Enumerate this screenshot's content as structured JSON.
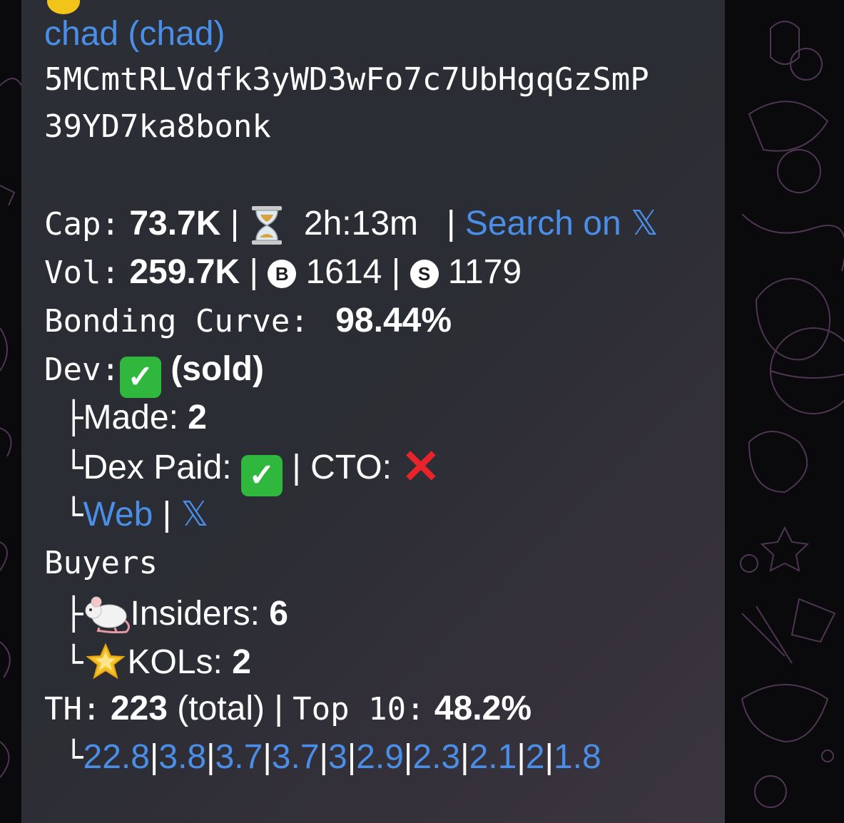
{
  "header": {
    "sender_link": "chad (chad)",
    "address_line1": "5MCmtRLVdfk3yWD3wFo7c7UbHgqGzSmP",
    "address_line2": "39YD7ka8bonk"
  },
  "cap": {
    "label": "Cap:",
    "value": "73.7K",
    "age": "2h:13m",
    "search_link": "Search on"
  },
  "vol": {
    "label": "Vol:",
    "value": "259.7K",
    "buy_icon_letter": "B",
    "buys": "1614",
    "sell_icon_letter": "S",
    "sells": "1179"
  },
  "bonding": {
    "label": "Bonding Curve:",
    "value": "98.44%"
  },
  "dev": {
    "label": "Dev:",
    "status": "(sold)",
    "made_label": "Made:",
    "made_value": "2",
    "dex_paid_label": "Dex Paid:",
    "cto_label": "CTO:",
    "web_link": "Web"
  },
  "buyers": {
    "label": "Buyers",
    "insiders_label": "Insiders:",
    "insiders_value": "6",
    "kols_label": "KOLs:",
    "kols_value": "2"
  },
  "holders": {
    "label": "TH:",
    "total_value": "223",
    "total_suffix": "(total)",
    "top10_label": "Top 10:",
    "top10_value": "48.2%",
    "top_list": [
      "22.8",
      "3.8",
      "3.7",
      "3.7",
      "3",
      "2.9",
      "2.3",
      "2.1",
      "2",
      "1.8"
    ]
  },
  "tree_glyphs": {
    "branch": "├",
    "last": "└"
  },
  "x_logo": "𝕏",
  "colors": {
    "link": "#4a8ee8",
    "check_green": "#2fb83d",
    "cross_red": "#e8232a",
    "bubble": "#2b2f35",
    "wallpaper": "#0a090c",
    "doodle": "#6a4a70"
  },
  "icons": [
    "hourglass-icon",
    "buy-coin-icon",
    "sell-coin-icon",
    "check-icon",
    "cross-icon",
    "rat-icon",
    "star-icon",
    "x-logo-icon"
  ]
}
